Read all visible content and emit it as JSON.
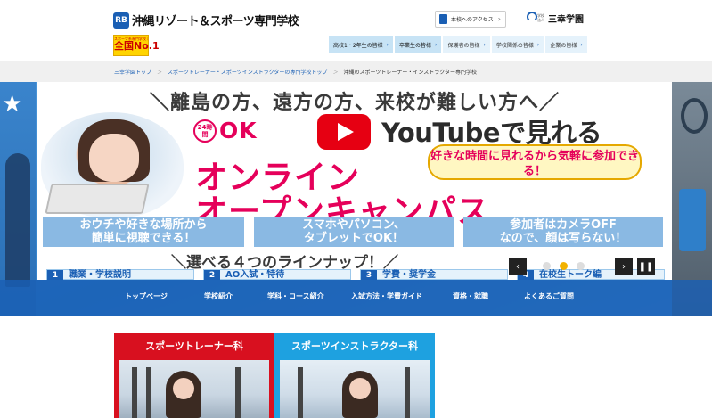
{
  "header": {
    "logo_mark": "RB",
    "school_name": "沖縄リゾート＆スポーツ専門学校",
    "badge_top": "スポーツ系専門学校 就職率",
    "badge_main": "全国No.1",
    "access_label": "本校へのアクセス",
    "group_small": "学校法人",
    "group_name": "三幸学園",
    "tabs": [
      {
        "label": "高校1・2年生の皆様"
      },
      {
        "label": "卒業生の皆様"
      },
      {
        "label": "保護者の皆様"
      },
      {
        "label": "学校関係の皆様"
      },
      {
        "label": "企業の皆様"
      }
    ]
  },
  "breadcrumb": {
    "items": [
      {
        "label": "三幸学園トップ"
      },
      {
        "label": "スポーツトレーナー・スポーツインストラクターの専門学校トップ"
      },
      {
        "label": "沖縄のスポーツトレーナー・インストラクター専門学校"
      }
    ],
    "separator": "＞"
  },
  "hero": {
    "headline": "＼離島の方、遠方の方、来校が難しい方へ／",
    "hour_badge": "24時間",
    "ok": "OK",
    "youtube": "YouTubeで見れる",
    "online_line1": "オンライン",
    "online_line2": "オープンキャンパス",
    "bubble": "好きな時間に見れるから気軽に参加できる！",
    "features": [
      {
        "text": "おウチや好きな場所から\n簡単に視聴できる！"
      },
      {
        "text": "スマホやパソコン、\nタブレットでOK！"
      },
      {
        "text": "参加者はカメラOFF\nなので、顔は写らない！"
      }
    ],
    "lineup": "＼選べる４つのラインナップ！／",
    "cards": [
      {
        "num": "1",
        "text": "職業・学校説明"
      },
      {
        "num": "2",
        "text": "AO入試・特待"
      },
      {
        "num": "3",
        "text": "学費・奨学金"
      },
      {
        "num": "4",
        "text": "在校生トーク編"
      }
    ],
    "slider": {
      "prev": "‹",
      "next": "›",
      "pause": "❚❚",
      "dot_count": 3,
      "active_dot": 2
    }
  },
  "nav": {
    "items": [
      {
        "label": "トップページ"
      },
      {
        "label": "学校紹介"
      },
      {
        "label": "学科・コース紹介"
      },
      {
        "label": "入試方法・学費ガイド"
      },
      {
        "label": "資格・就職"
      },
      {
        "label": "よくあるご質問"
      }
    ]
  },
  "courses": [
    {
      "title": "スポーツトレーナー科",
      "color": "#d8101f"
    },
    {
      "title": "スポーツインストラクター科",
      "color": "#1ea1e0"
    }
  ],
  "colors": {
    "brand_blue": "#1a5fb4",
    "accent_pink": "#e5005a",
    "youtube_red": "#e60012",
    "slider_active": "#f2b200"
  }
}
